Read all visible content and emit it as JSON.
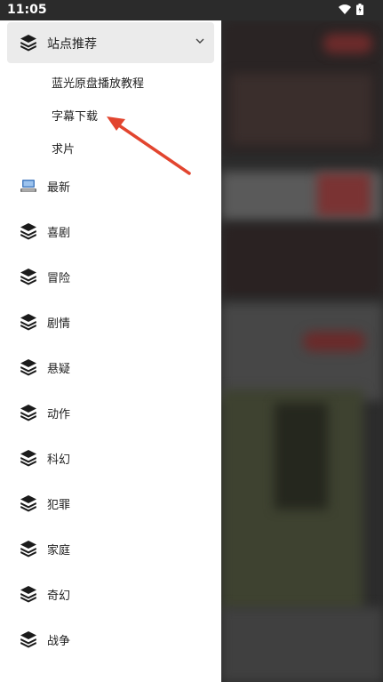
{
  "status_bar": {
    "time": "11:05"
  },
  "drawer": {
    "header": {
      "label": "站点推荐",
      "expanded": true
    },
    "sub_items": [
      {
        "label": "蓝光原盘播放教程"
      },
      {
        "label": "字幕下载"
      },
      {
        "label": "求片"
      }
    ],
    "items": [
      {
        "label": "最新",
        "icon": "computer-icon"
      },
      {
        "label": "喜剧",
        "icon": "layers-icon"
      },
      {
        "label": "冒险",
        "icon": "layers-icon"
      },
      {
        "label": "剧情",
        "icon": "layers-icon"
      },
      {
        "label": "悬疑",
        "icon": "layers-icon"
      },
      {
        "label": "动作",
        "icon": "layers-icon"
      },
      {
        "label": "科幻",
        "icon": "layers-icon"
      },
      {
        "label": "犯罪",
        "icon": "layers-icon"
      },
      {
        "label": "家庭",
        "icon": "layers-icon"
      },
      {
        "label": "奇幻",
        "icon": "layers-icon"
      },
      {
        "label": "战争",
        "icon": "layers-icon"
      }
    ]
  },
  "colors": {
    "annotation_arrow": "#e2452f",
    "accent_red": "#c63a3a"
  }
}
